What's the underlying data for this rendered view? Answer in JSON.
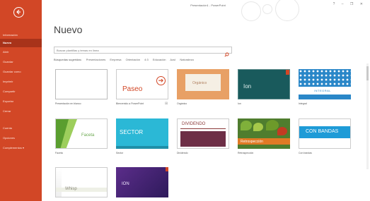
{
  "window": {
    "title": "Presentación1 - PowerPoint",
    "controls": "?  –  ❐  ✕"
  },
  "sidebar": {
    "items": [
      {
        "label": "Información"
      },
      {
        "label": "Nuevo"
      },
      {
        "label": "Abrir"
      },
      {
        "label": "Guardar"
      },
      {
        "label": "Guardar como"
      },
      {
        "label": "Imprimir"
      },
      {
        "label": "Compartir"
      },
      {
        "label": "Exportar"
      },
      {
        "label": "Cerrar"
      },
      {
        "label": "Cuenta"
      },
      {
        "label": "Opciones"
      },
      {
        "label": "Complementos ▾"
      }
    ]
  },
  "main": {
    "title": "Nuevo",
    "search": {
      "placeholder": "Buscar plantillas y temas en línea"
    },
    "suggestions": {
      "label": "Búsquedas sugeridas:",
      "items": [
        "Presentaciones",
        "Empresa",
        "Orientación",
        "4:3",
        "Educación",
        "Azul",
        "Naturaleza"
      ]
    },
    "templates": [
      {
        "name": "Presentación en blanco",
        "text": ""
      },
      {
        "name": "Bienvenido a PowerPoint",
        "text": "Paseo"
      },
      {
        "name": "Orgánico",
        "text": "Orgánico"
      },
      {
        "name": "Ion",
        "text": "Ion"
      },
      {
        "name": "Integral",
        "text": "INTEGRAL"
      },
      {
        "name": "Faceta",
        "text": "Faceta"
      },
      {
        "name": "Sector",
        "text": "SECTOR"
      },
      {
        "name": "Dividendo",
        "text": "DIVIDENDO"
      },
      {
        "name": "Retrospección",
        "text": "Retrospección"
      },
      {
        "name": "Con bandas",
        "text": "CON BANDAS"
      },
      {
        "name": "",
        "text": "Whisp"
      },
      {
        "name": "",
        "text": "ION"
      }
    ]
  },
  "colors": {
    "accent": "#d24726",
    "sidebar_active": "#a8331a"
  }
}
